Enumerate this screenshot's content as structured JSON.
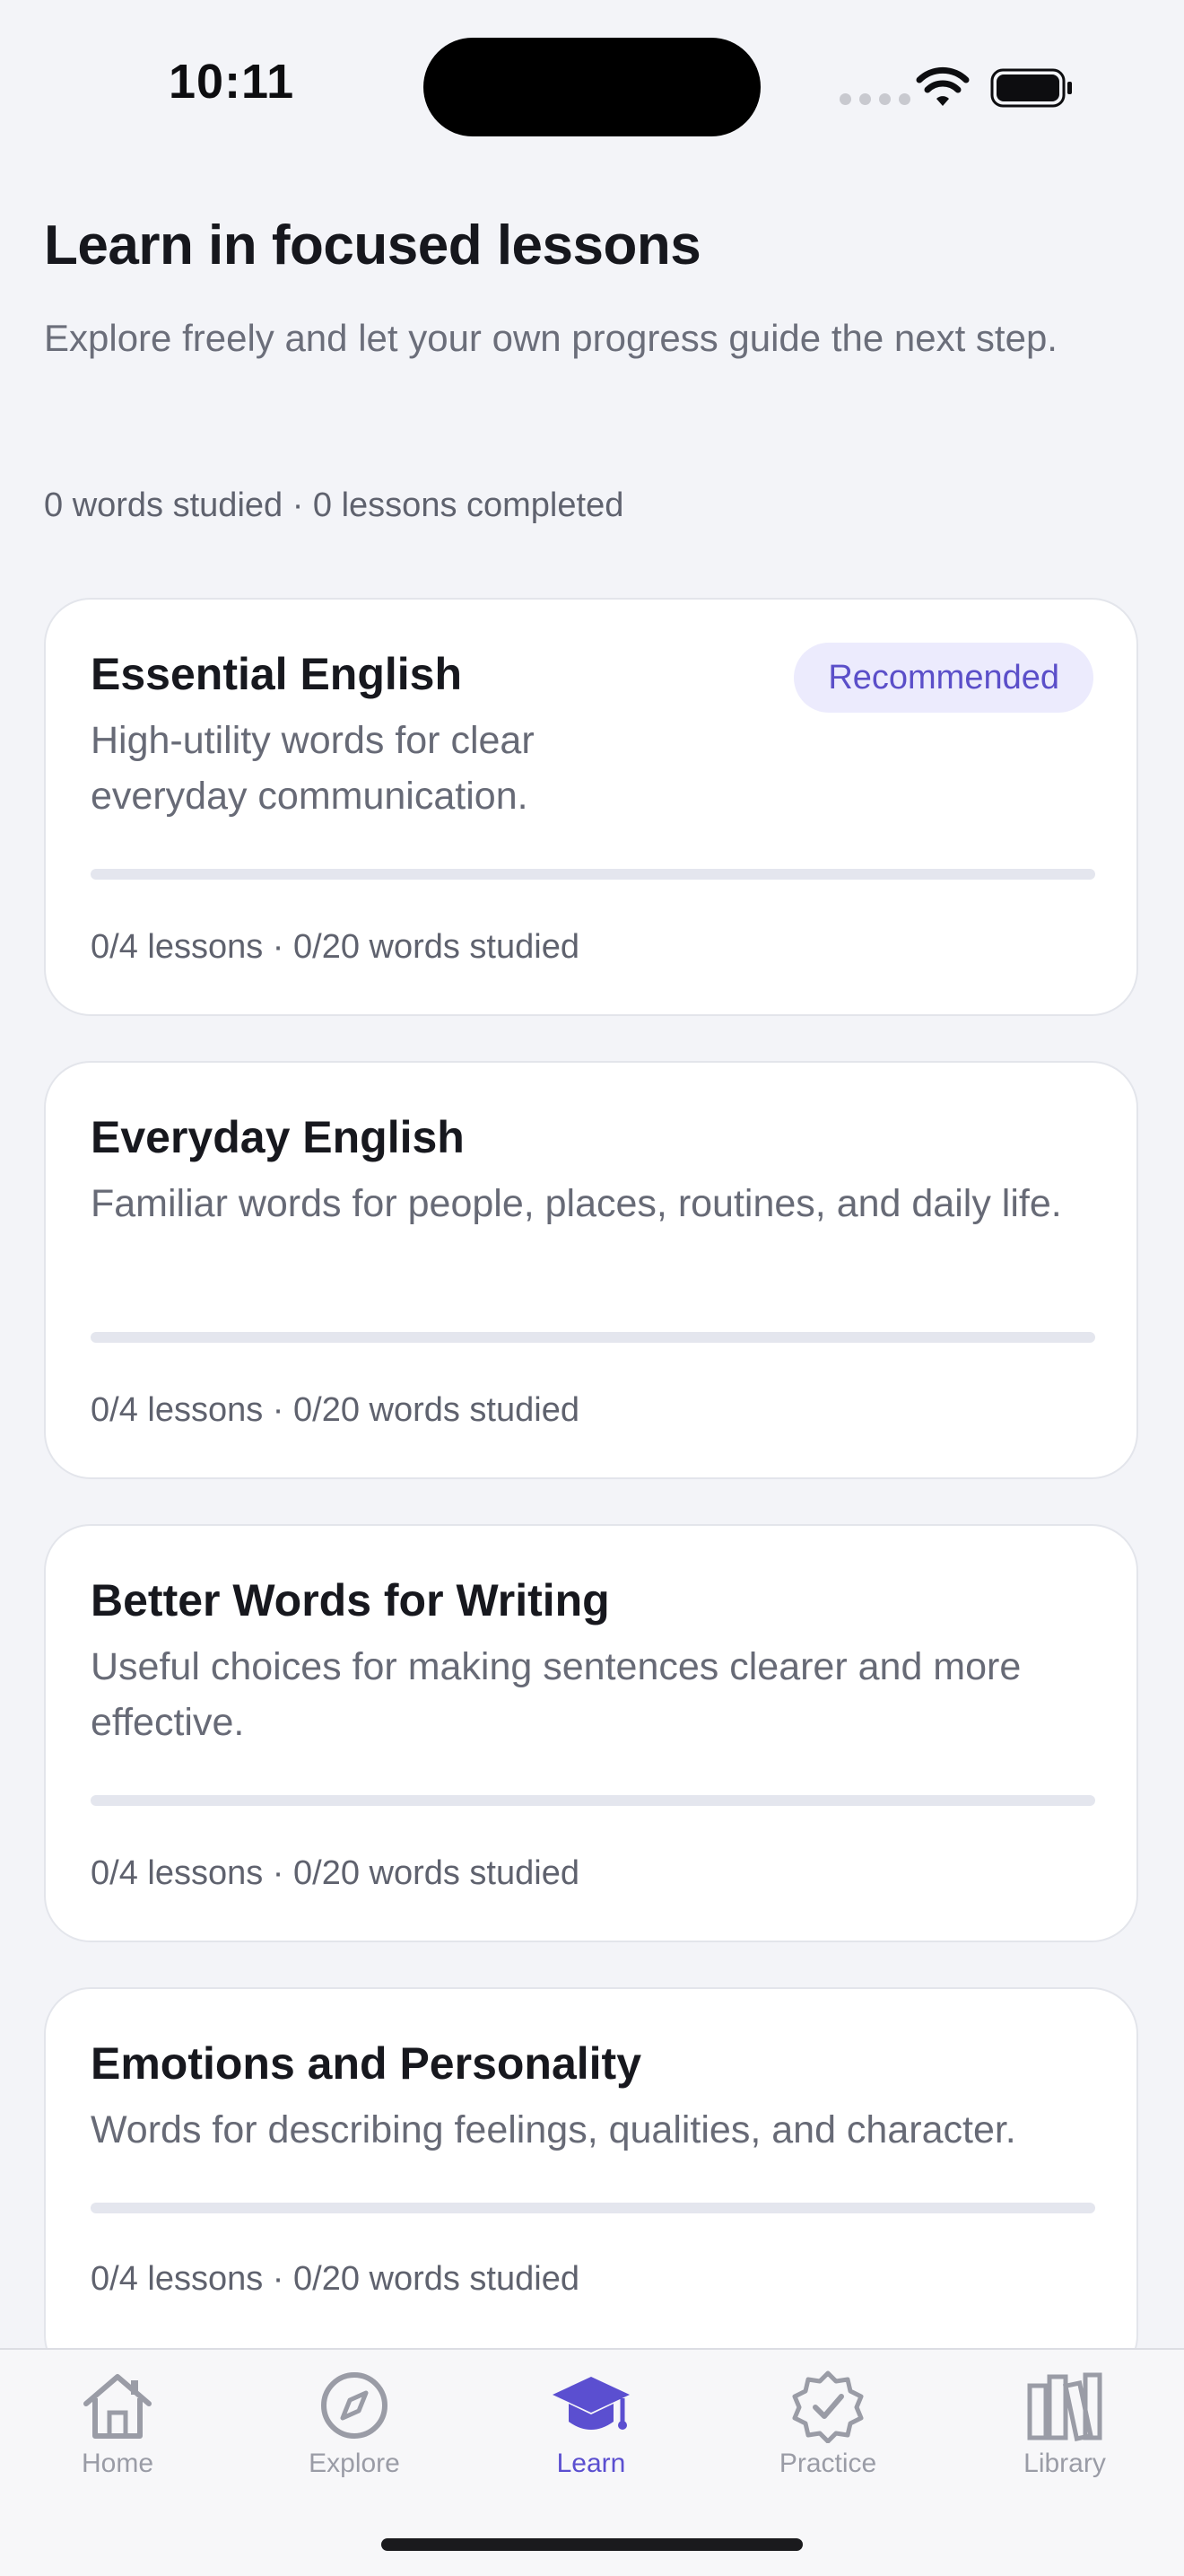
{
  "status_bar": {
    "time": "10:11"
  },
  "header": {
    "title": "Learn in focused lessons",
    "subtitle": "Explore freely and let your own progress guide the next step.",
    "stats": "0 words studied · 0 lessons completed"
  },
  "courses": [
    {
      "title": "Essential English",
      "description": "High-utility words for clear everyday communication.",
      "badge": "Recommended",
      "progress_fraction": 0,
      "meta": "0/4 lessons · 0/20 words studied"
    },
    {
      "title": "Everyday English",
      "description": "Familiar words for people, places, routines, and daily life.",
      "progress_fraction": 0,
      "meta": "0/4 lessons · 0/20 words studied"
    },
    {
      "title": "Better Words for Writing",
      "description": "Useful choices for making sentences clearer and more effective.",
      "progress_fraction": 0,
      "meta": "0/4 lessons · 0/20 words studied"
    },
    {
      "title": "Emotions and Personality",
      "description": "Words for describing feelings, qualities, and character.",
      "progress_fraction": 0,
      "meta": "0/4 lessons · 0/20 words studied"
    }
  ],
  "tab_bar": {
    "tabs": [
      {
        "label": "Home",
        "icon": "house-icon",
        "active": false
      },
      {
        "label": "Explore",
        "icon": "compass-icon",
        "active": false
      },
      {
        "label": "Learn",
        "icon": "graduation-cap-icon",
        "active": true
      },
      {
        "label": "Practice",
        "icon": "checkmark-seal-icon",
        "active": false
      },
      {
        "label": "Library",
        "icon": "books-icon",
        "active": false
      }
    ]
  },
  "colors": {
    "accent": "#5b4fd0",
    "badge_background": "#ecebfd",
    "background": "#f3f4f8",
    "inactive_tab": "#9a9ca6"
  }
}
